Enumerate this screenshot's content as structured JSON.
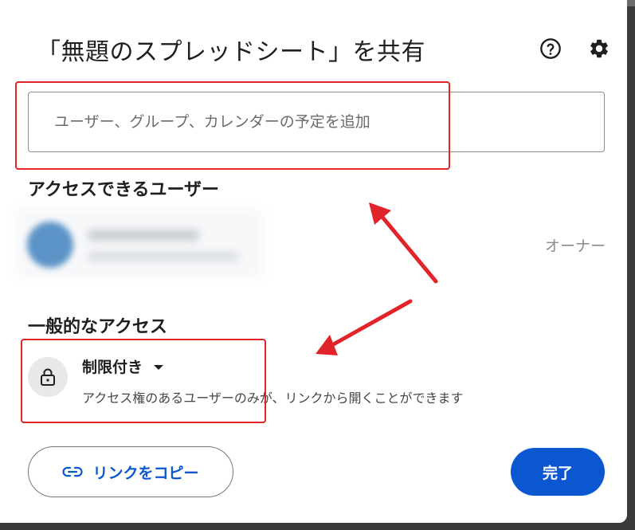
{
  "dialog": {
    "title": "「無題のスプレッドシート」を共有",
    "help_icon": "help-circle-icon",
    "settings_icon": "gear-icon"
  },
  "add_people": {
    "placeholder": "ユーザー、グループ、カレンダーの予定を追加",
    "value": ""
  },
  "people_section": {
    "title": "アクセスできるユーザー",
    "users": [
      {
        "role": "オーナー"
      }
    ]
  },
  "general_access": {
    "title": "一般的なアクセス",
    "mode_label": "制限付き",
    "description": "アクセス権のあるユーザーのみが、リンクから開くことができます",
    "icon": "lock-icon"
  },
  "footer": {
    "copy_link_label": "リンクをコピー",
    "copy_link_icon": "link-icon",
    "done_label": "完了"
  },
  "colors": {
    "primary": "#0b57d0",
    "annotation_red": "#e0242a",
    "text": "#1f1f1f",
    "secondary_text": "#444746"
  }
}
